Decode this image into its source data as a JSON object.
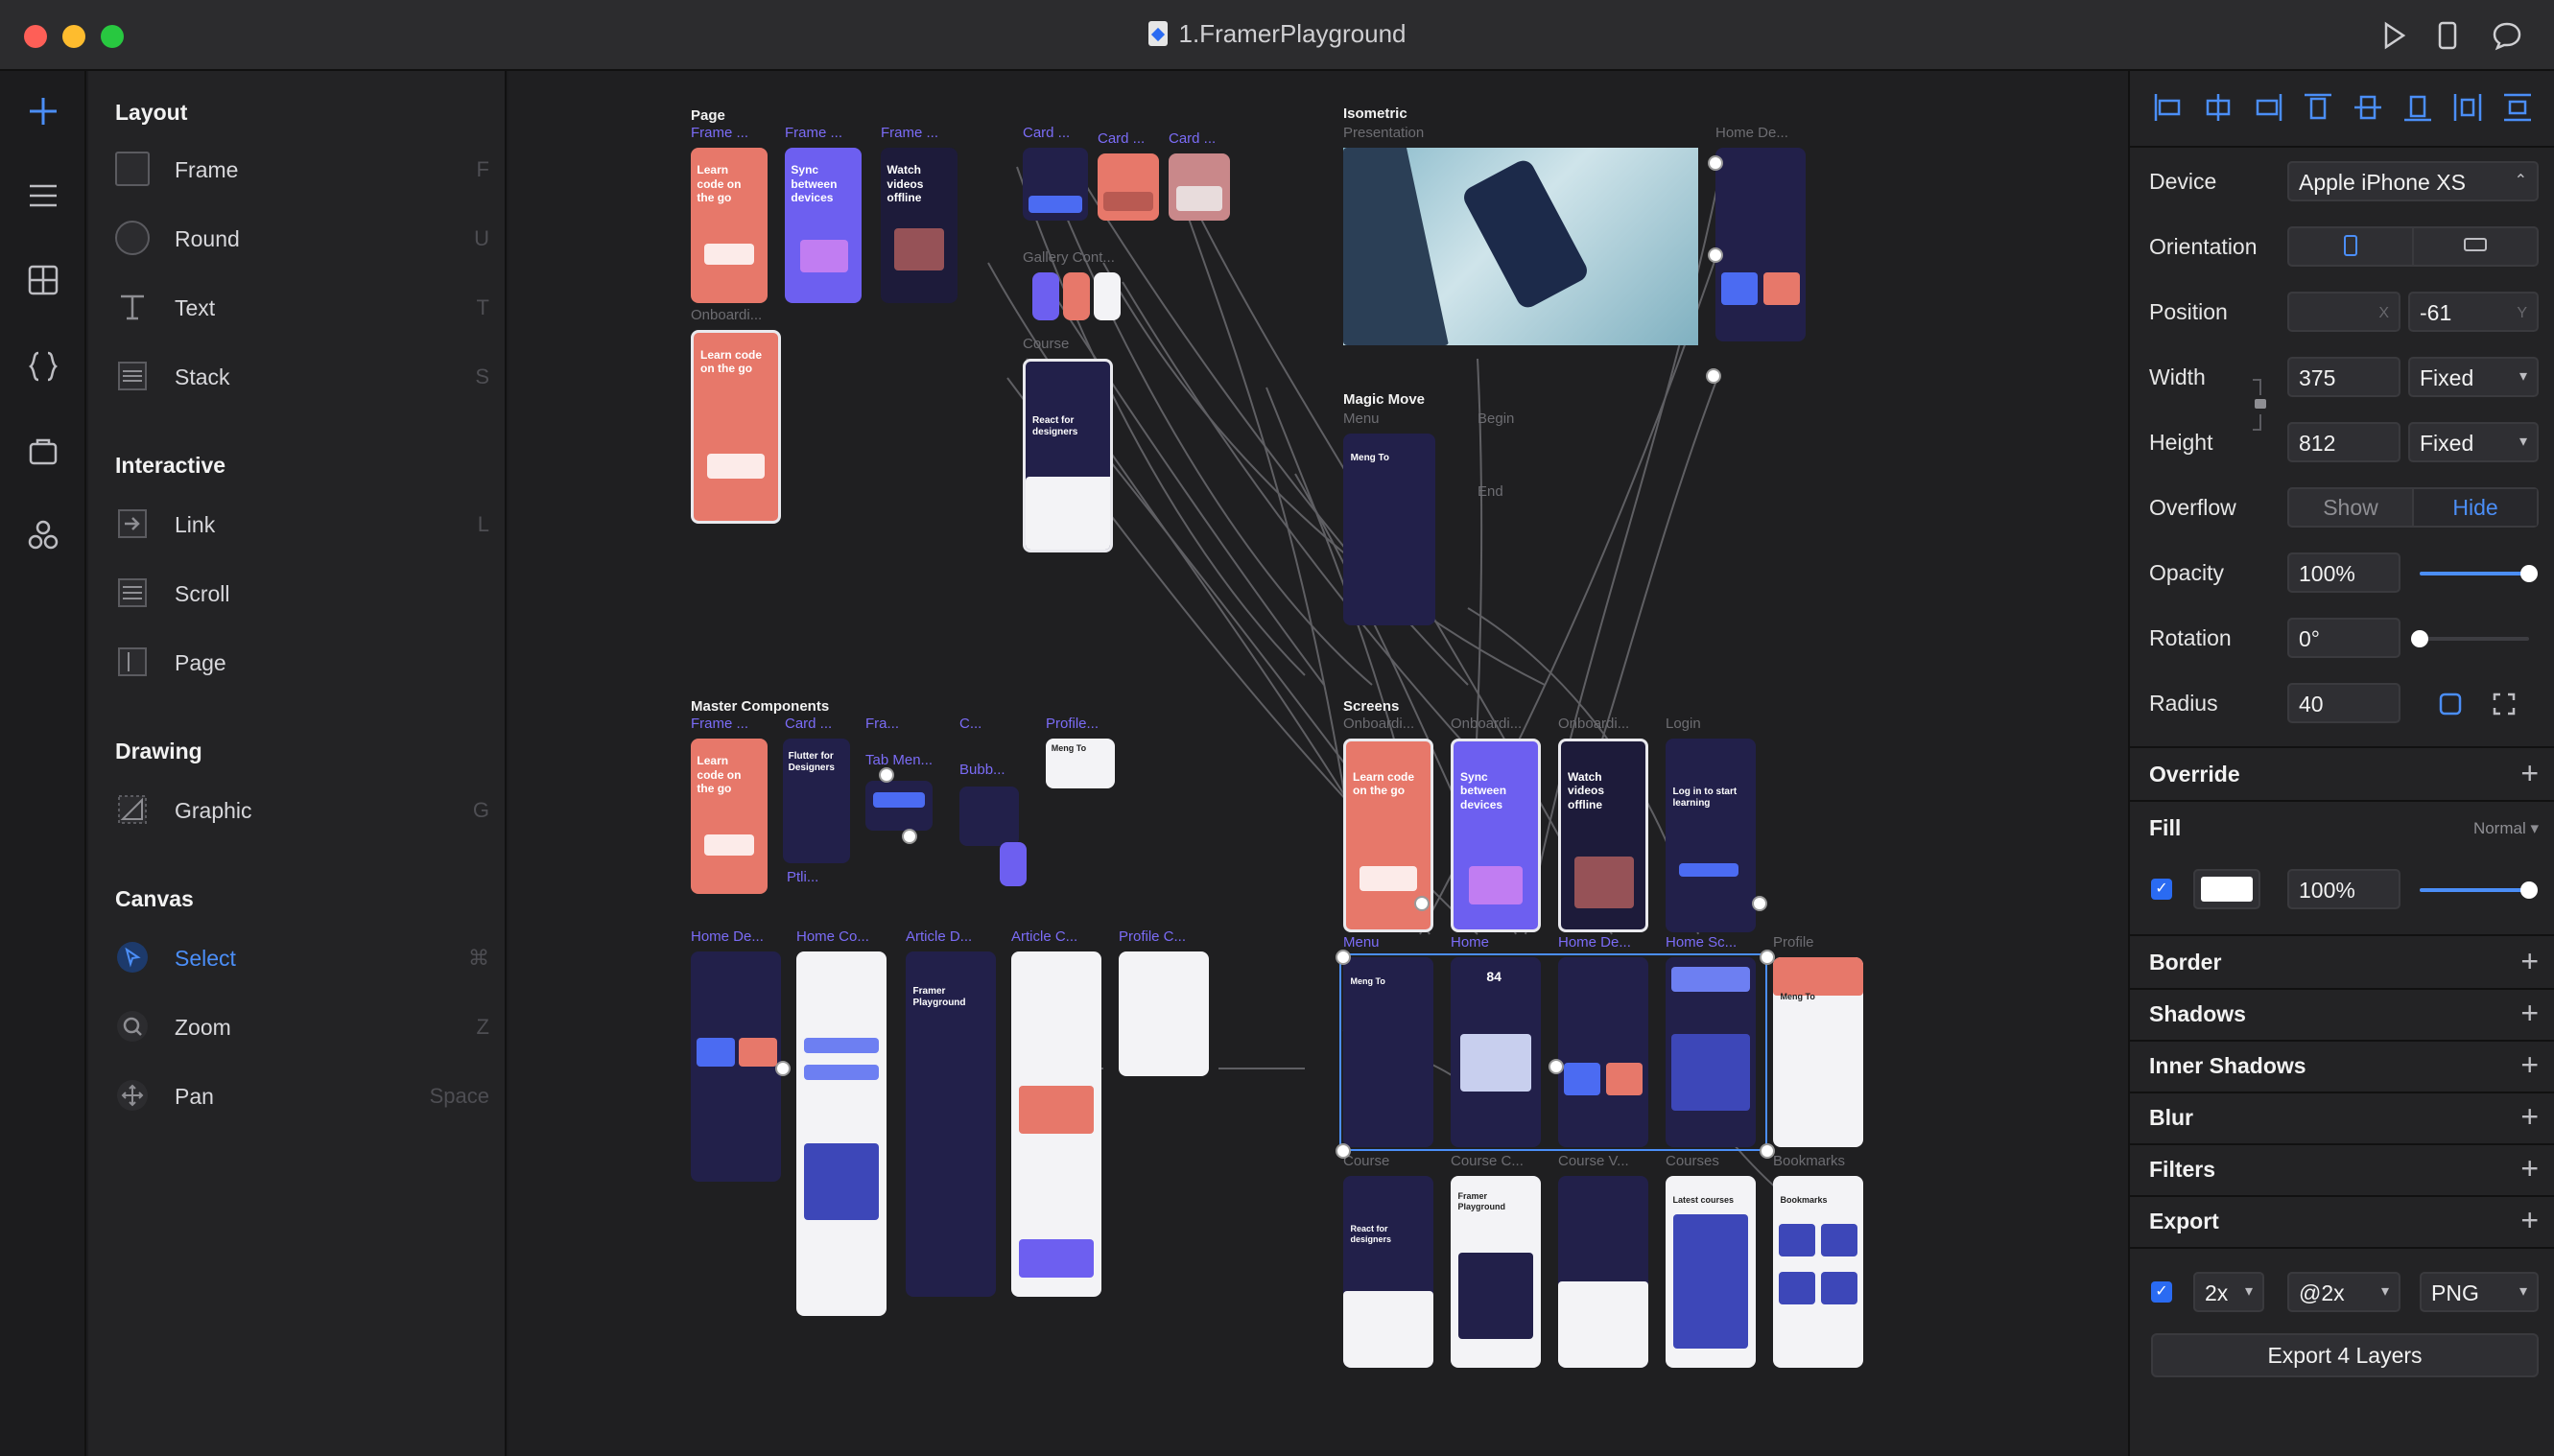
{
  "window": {
    "title": "1.FramerPlayground"
  },
  "toolbar": {
    "icons": [
      "play-icon",
      "device-icon",
      "comment-icon"
    ]
  },
  "rail": {
    "icons": [
      "plus-icon",
      "layers-icon",
      "grid-icon",
      "code-icon",
      "store-icon",
      "components-icon"
    ]
  },
  "insert": {
    "layout": {
      "title": "Layout",
      "items": [
        {
          "label": "Frame",
          "key": "F"
        },
        {
          "label": "Round",
          "key": "U"
        },
        {
          "label": "Text",
          "key": "T"
        },
        {
          "label": "Stack",
          "key": "S"
        }
      ]
    },
    "interactive": {
      "title": "Interactive",
      "items": [
        {
          "label": "Link",
          "key": "L"
        },
        {
          "label": "Scroll",
          "key": ""
        },
        {
          "label": "Page",
          "key": ""
        }
      ]
    },
    "drawing": {
      "title": "Drawing",
      "items": [
        {
          "label": "Graphic",
          "key": "G"
        }
      ]
    },
    "canvas": {
      "title": "Canvas",
      "items": [
        {
          "label": "Select",
          "key": "⌘"
        },
        {
          "label": "Zoom",
          "key": "Z"
        },
        {
          "label": "Pan",
          "key": "Space"
        }
      ]
    }
  },
  "canvas": {
    "groups": {
      "page": "Page",
      "isometric": "Isometric",
      "magic_move": "Magic Move",
      "master_components": "Master Components",
      "screens": "Screens"
    },
    "labels": {
      "frame_1": "Frame ...",
      "frame_2": "Frame ...",
      "frame_3": "Frame ...",
      "onboarding": "Onboardi...",
      "card_1": "Card ...",
      "card_2": "Card ...",
      "card_3": "Card ...",
      "gallery": "Gallery Cont...",
      "course": "Course",
      "presentation": "Presentation",
      "home_de_top": "Home De...",
      "menu_mm": "Menu",
      "begin": "Begin",
      "end": "End",
      "mc_frame": "Frame ...",
      "mc_card": "Card ...",
      "mc_fra": "Fra...",
      "mc_c": "C...",
      "mc_profile": "Profile...",
      "mc_tab": "Tab Men...",
      "mc_bubb": "Bubb...",
      "home_de_2": "Home De...",
      "home_co": "Home Co...",
      "article_d": "Article D...",
      "article_c": "Article C...",
      "profile_c": "Profile C...",
      "s_onb_1": "Onboardi...",
      "s_onb_2": "Onboardi...",
      "s_onb_3": "Onboardi...",
      "s_login": "Login",
      "s_menu": "Menu",
      "s_home": "Home",
      "s_home_de": "Home De...",
      "s_home_sc": "Home Sc...",
      "s_profile": "Profile",
      "s_course": "Course",
      "s_course_2": "Course C...",
      "s_course_3": "Course V...",
      "s_courses": "Courses",
      "s_bookmarks": "Bookmarks"
    },
    "texts": {
      "learn": "Learn code on the go",
      "sync": "Sync between devices",
      "watch": "Watch videos offline",
      "react": "React for designers",
      "login": "Log in to start learning",
      "flutter": "Flutter for Designers",
      "framer_playground": "Framer Playground",
      "latest_courses": "Latest courses",
      "bookmarks": "Bookmarks",
      "meng": "Meng To",
      "count": "84",
      "ptli": "Ptli..."
    }
  },
  "props": {
    "device": {
      "label": "Device",
      "value": "Apple iPhone XS"
    },
    "orientation": {
      "label": "Orientation"
    },
    "position": {
      "label": "Position",
      "x": "",
      "y": "-61",
      "x_suffix": "X",
      "y_suffix": "Y"
    },
    "width": {
      "label": "Width",
      "value": "375",
      "mode": "Fixed"
    },
    "height": {
      "label": "Height",
      "value": "812",
      "mode": "Fixed"
    },
    "overflow": {
      "label": "Overflow",
      "show": "Show",
      "hide": "Hide"
    },
    "opacity": {
      "label": "Opacity",
      "value": "100%",
      "level": 1.0
    },
    "rotation": {
      "label": "Rotation",
      "value": "0°",
      "level": 0.0
    },
    "radius": {
      "label": "Radius",
      "value": "40"
    },
    "override": "Override",
    "fill": {
      "label": "Fill",
      "blend": "Normal",
      "color": "#ffffff",
      "opacity": "100%",
      "level": 1.0
    },
    "border": "Border",
    "shadows": "Shadows",
    "inner_shadows": "Inner Shadows",
    "blur": "Blur",
    "filters": "Filters",
    "export": {
      "label": "Export",
      "scale": "2x",
      "suffix": "@2x",
      "format": "PNG",
      "button": "Export 4 Layers"
    }
  },
  "colors": {
    "accent": "#4b8ef7",
    "coral": "#e7786a",
    "purple": "#6d5ff0"
  }
}
